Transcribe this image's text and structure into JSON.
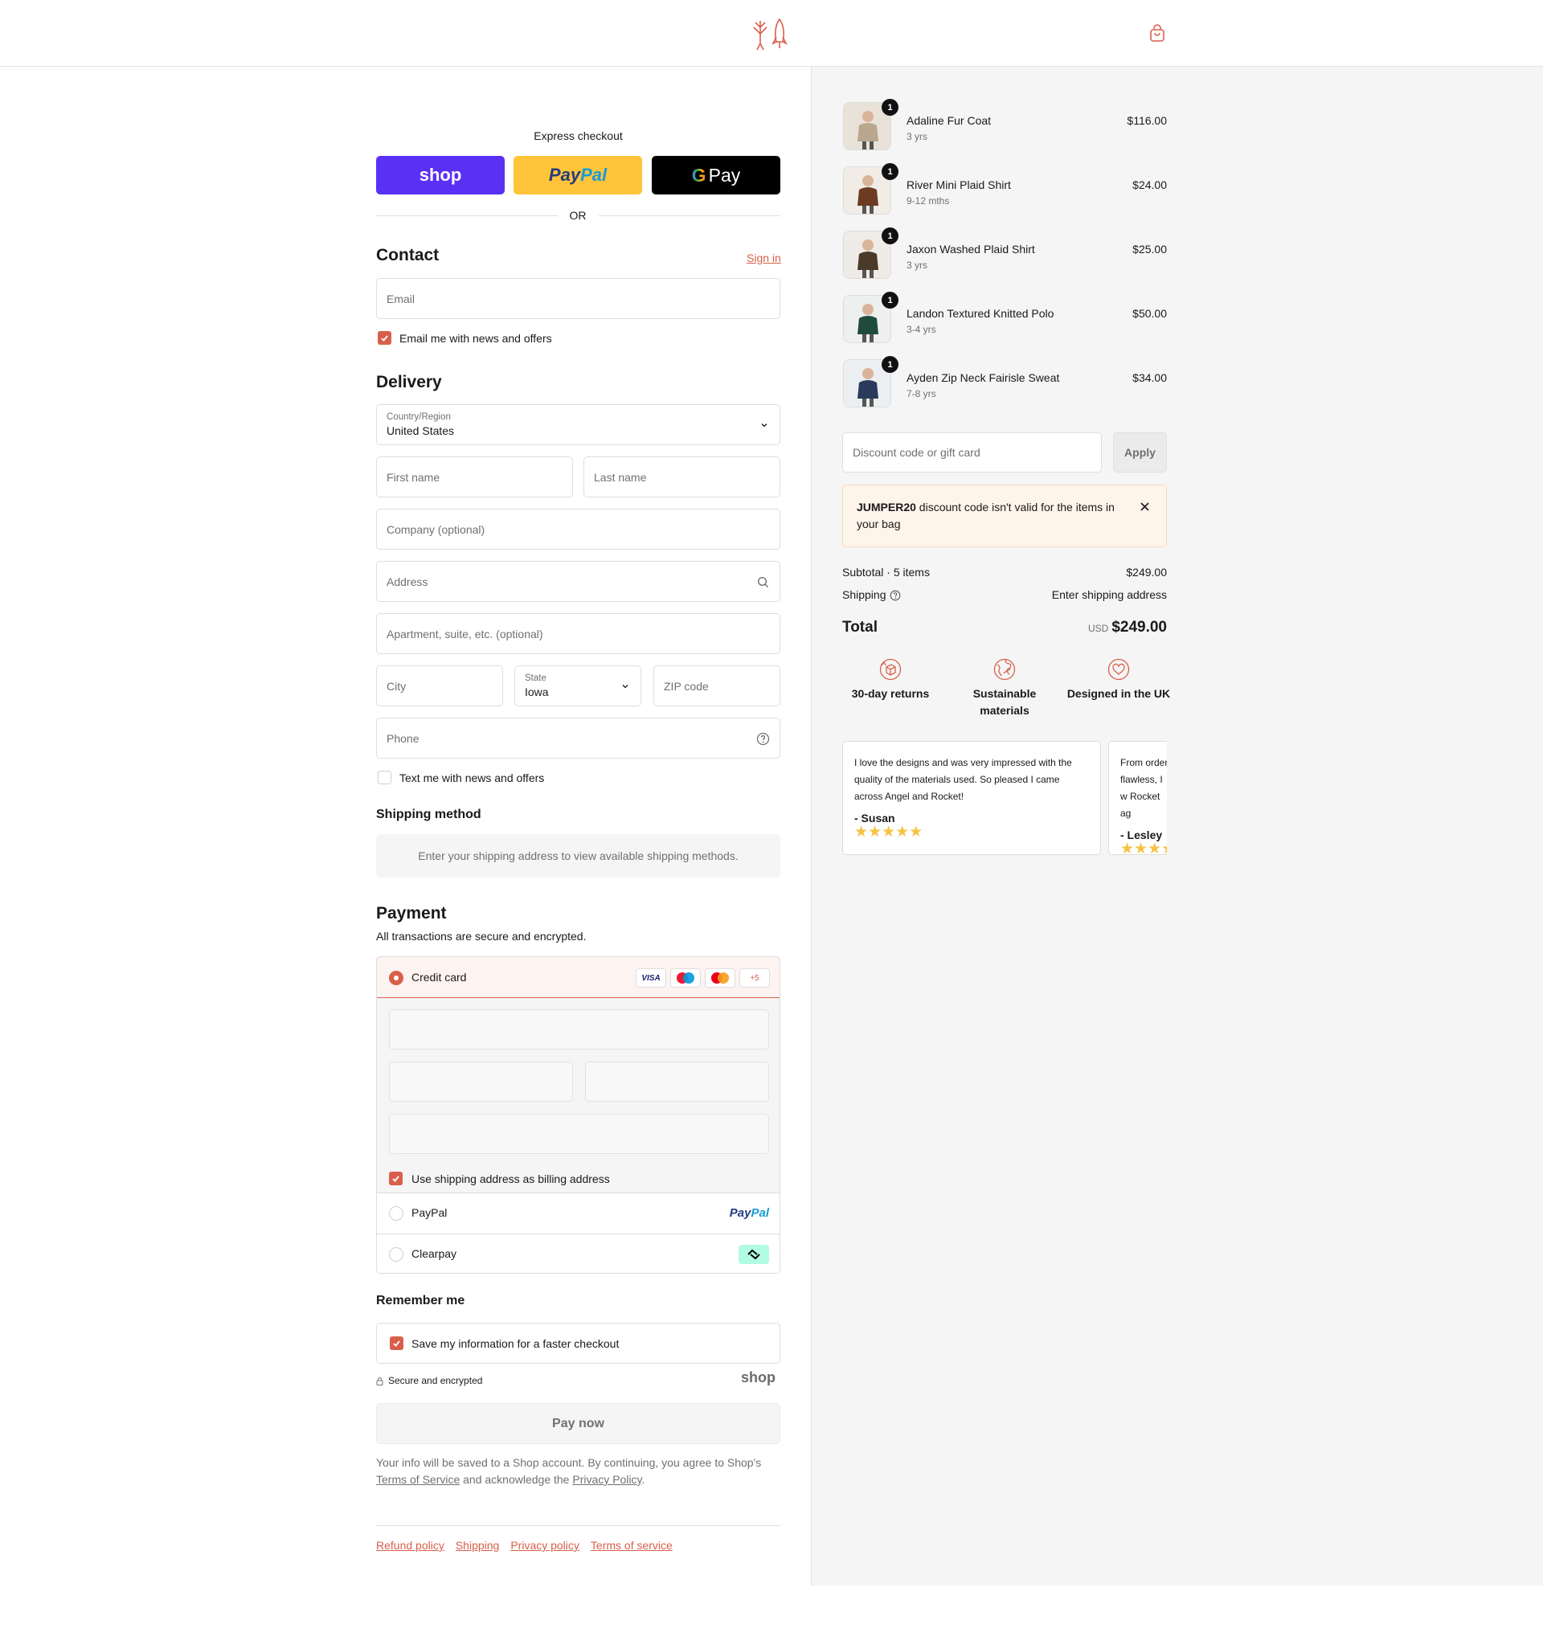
{
  "header": {
    "logo": "rocket-logo-icon",
    "bag_icon": "shopping-bag-icon"
  },
  "express": {
    "title": "Express checkout",
    "or": "OR",
    "shop_label": "shop",
    "paypal_label1": "Pay",
    "paypal_label2": "Pal",
    "gpay_label": "Pay"
  },
  "contact": {
    "title": "Contact",
    "signin": "Sign in",
    "email_placeholder": "Email",
    "news_label": "Email me with news and offers"
  },
  "delivery": {
    "title": "Delivery",
    "country_label": "Country/Region",
    "country_value": "United States",
    "first_name": "First name",
    "last_name": "Last name",
    "company": "Company (optional)",
    "address": "Address",
    "apartment": "Apartment, suite, etc. (optional)",
    "city": "City",
    "state_label": "State",
    "state_value": "Iowa",
    "zip": "ZIP code",
    "phone": "Phone",
    "text_label": "Text me with news and offers"
  },
  "shipping_method": {
    "title": "Shipping method",
    "message": "Enter your shipping address to view available shipping methods."
  },
  "payment": {
    "title": "Payment",
    "subtitle": "All transactions are secure and encrypted.",
    "credit_card": "Credit card",
    "card_brands": [
      "VISA",
      "maestro",
      "mastercard",
      "+5"
    ],
    "billing_label": "Use shipping address as billing address",
    "paypal": "PayPal",
    "paypal_logo1": "Pay",
    "paypal_logo2": "Pal",
    "clearpay": "Clearpay"
  },
  "remember": {
    "title": "Remember me",
    "save_label": "Save my information for a faster checkout",
    "secure": "Secure and encrypted",
    "shop_logo": "shop"
  },
  "pay_button": "Pay now",
  "legal": {
    "line1": "Your info will be saved to a Shop account. By continuing, you agree to Shop's",
    "tos": "Terms of Service",
    "mid": " and acknowledge the ",
    "privacy": "Privacy Policy",
    "end": "."
  },
  "footer_links": [
    "Refund policy",
    "Shipping",
    "Privacy policy",
    "Terms of service"
  ],
  "order": {
    "items": [
      {
        "name": "Adaline Fur Coat",
        "variant": "3 yrs",
        "price": "$116.00",
        "qty": "1"
      },
      {
        "name": "River Mini Plaid Shirt",
        "variant": "9-12 mths",
        "price": "$24.00",
        "qty": "1"
      },
      {
        "name": "Jaxon Washed Plaid Shirt",
        "variant": "3 yrs",
        "price": "$25.00",
        "qty": "1"
      },
      {
        "name": "Landon Textured Knitted Polo",
        "variant": "3-4 yrs",
        "price": "$50.00",
        "qty": "1"
      },
      {
        "name": "Ayden Zip Neck Fairisle Sweat",
        "variant": "7-8 yrs",
        "price": "$34.00",
        "qty": "1"
      }
    ],
    "discount_placeholder": "Discount code or gift card",
    "apply": "Apply",
    "error_code": "JUMPER20",
    "error_text": " discount code isn't valid for the items in your bag",
    "subtotal_label": "Subtotal · 5 items",
    "subtotal_value": "$249.00",
    "shipping_label": "Shipping",
    "shipping_value": "Enter shipping address",
    "total_label": "Total",
    "currency": "USD",
    "total_value": "$249.00"
  },
  "features": [
    {
      "icon": "returns-box-icon",
      "label": "30-day returns"
    },
    {
      "icon": "globe-leaf-icon",
      "label": "Sustainable materials"
    },
    {
      "icon": "heart-icon",
      "label": "Designed in the UK"
    }
  ],
  "reviews": [
    {
      "text": "I love the designs and was very impressed with the quality of the materials used. So pleased I came across Angel and Rocket!",
      "author": "- Susan",
      "stars": "★★★★★"
    },
    {
      "text": "From order flawless, I w Rocket ag",
      "author": "- Lesley",
      "stars": "★★★★★"
    }
  ],
  "colors": {
    "accent": "#d8604b",
    "shop": "#5a31f4",
    "paypal": "#ffc439",
    "gpay": "#000000"
  }
}
